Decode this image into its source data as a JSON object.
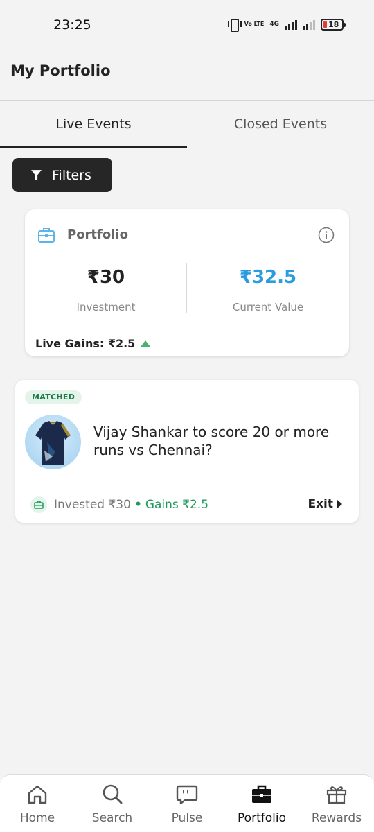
{
  "status_bar": {
    "time": "23:25",
    "network_label": "Vo LTE",
    "network_type": "4G",
    "battery": "18"
  },
  "header": {
    "title": "My Portfolio"
  },
  "tabs": [
    {
      "label": "Live Events",
      "active": true
    },
    {
      "label": "Closed Events",
      "active": false
    }
  ],
  "filters": {
    "label": "Filters",
    "icon": "filter-icon"
  },
  "portfolio": {
    "title": "Portfolio",
    "icon": "briefcase-icon",
    "investment_value": "₹30",
    "investment_label": "Investment",
    "current_value": "₹32.5",
    "current_value_label": "Current Value",
    "live_gains": "Live Gains: ₹2.5"
  },
  "event": {
    "status": "MATCHED",
    "question": "Vijay Shankar to score 20 or more runs vs Chennai?",
    "invested": "Invested ₹30",
    "gains": "Gains ₹2.5",
    "exit_label": "Exit"
  },
  "nav": [
    {
      "label": "Home",
      "icon": "home-icon"
    },
    {
      "label": "Search",
      "icon": "search-icon"
    },
    {
      "label": "Pulse",
      "icon": "pulse-icon"
    },
    {
      "label": "Portfolio",
      "icon": "briefcase-icon",
      "active": true
    },
    {
      "label": "Rewards",
      "icon": "gift-icon"
    }
  ],
  "colors": {
    "accent_blue": "#2a9de0",
    "gain_green": "#1e9a5c",
    "dark_button": "#262626"
  }
}
